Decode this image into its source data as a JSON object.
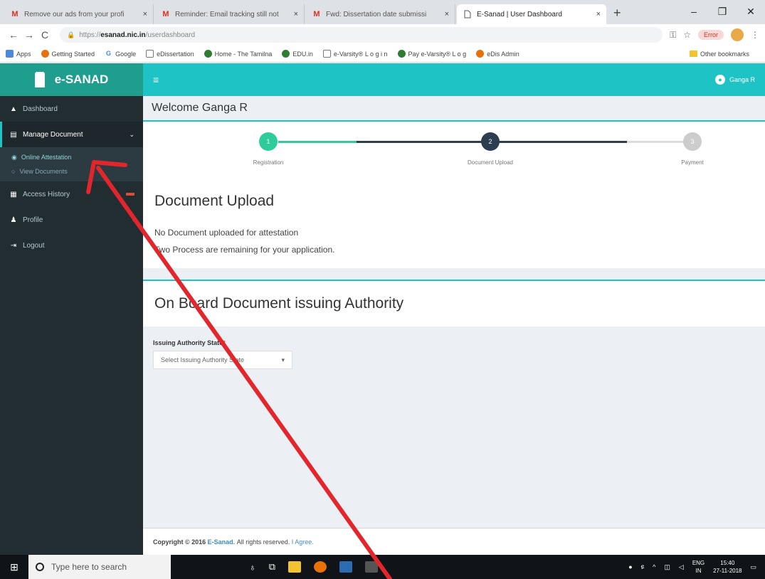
{
  "browser": {
    "tabs": [
      {
        "favicon": "M",
        "title": "Remove our ads from your profi",
        "active": false
      },
      {
        "favicon": "M",
        "title": "Reminder: Email tracking still not",
        "active": false
      },
      {
        "favicon": "M",
        "title": "Fwd: Dissertation date submissi",
        "active": false
      },
      {
        "favicon": "page-icon",
        "title": "E-Sanad | User Dashboard",
        "active": true
      }
    ],
    "close_glyph": "×",
    "new_tab_glyph": "+",
    "window_controls": [
      "–",
      "❐",
      "✕"
    ],
    "url_scheme": "https://",
    "url_host": "esanad.nic.in",
    "url_path": "/userdashboard",
    "error_label": "Error",
    "bookmarks": [
      {
        "label": "Apps",
        "color": "#4a89dc"
      },
      {
        "label": "Getting Started",
        "color": "#e8710a"
      },
      {
        "label": "Google",
        "color": "#4285f4",
        "glyph": "G"
      },
      {
        "label": "eDissertation",
        "color": "#777777"
      },
      {
        "label": "Home - The Tamilna",
        "color": "#2e7d32"
      },
      {
        "label": "EDU.in",
        "color": "#2e7d32"
      },
      {
        "label": "e-Varsity® L o g i n",
        "color": "#777777"
      },
      {
        "label": "Pay e-Varsity® L o g",
        "color": "#2e7d32"
      },
      {
        "label": "eDis Admin",
        "color": "#e8710a"
      }
    ],
    "other_bookmarks": "Other bookmarks"
  },
  "app": {
    "brand": "e-SANAD",
    "menu_glyph": "≡",
    "user_name": "Ganga R",
    "sidebar": {
      "dashboard": "Dashboard",
      "manage_document": "Manage Document",
      "online_attestation": "Online Attestation",
      "view_documents": "View Documents",
      "access_history": "Access History",
      "profile": "Profile",
      "logout": "Logout"
    },
    "welcome": "Welcome Ganga R",
    "steps": [
      {
        "num": "1",
        "label": "Registration"
      },
      {
        "num": "2",
        "label": "Document Upload"
      },
      {
        "num": "3",
        "label": "Payment"
      }
    ],
    "upload_title": "Document Upload",
    "msg1": "No Document uploaded for attestation",
    "msg2": "Two Process are remaining for your application.",
    "authority_title": "On Board Document issuing Authority",
    "field_label": "Issuing Authority State",
    "required_mark": "*",
    "select_placeholder": "Select Issuing Authority State",
    "footer_prefix": "Copyright © 2016",
    "footer_brand": "E-Sanad.",
    "footer_rights": "All rights reserved.",
    "footer_agree": "I Agree."
  },
  "taskbar": {
    "search_placeholder": "Type here to search",
    "lang_top": "ENG",
    "lang_bottom": "IN",
    "time": "15:40",
    "date": "27-11-2018"
  },
  "colors": {
    "brand_teal": "#1f9e8d",
    "topbar_cyan": "#1ec3c5",
    "sidebar_dark": "#222d32",
    "step_done": "#2ecc9a",
    "step_current": "#2c3e50",
    "step_pending": "#cccccc",
    "annotation_red": "#e3262b"
  }
}
